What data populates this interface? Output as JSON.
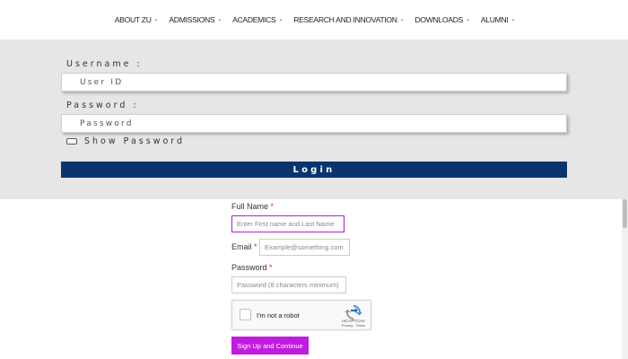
{
  "nav": {
    "items": [
      {
        "label": "ABOUT ZU"
      },
      {
        "label": "ADMISSIONS"
      },
      {
        "label": "ACADEMICS"
      },
      {
        "label": "RESEARCH AND INNOVATION"
      },
      {
        "label": "DOWNLOADS"
      },
      {
        "label": "ALUMNI"
      }
    ],
    "dropdown_icon": "chevron-down-icon"
  },
  "login": {
    "username_label": "Username :",
    "username_placeholder": "User ID",
    "password_label": "Password :",
    "password_placeholder": "Password",
    "show_password_label": "Show Password",
    "login_button": "Login"
  },
  "signup": {
    "fullname_label": "Full Name",
    "fullname_placeholder": "Enter First name and Last Name",
    "email_label": "Email",
    "email_placeholder": "Example@something.com",
    "password_label": "Password",
    "password_placeholder": "Password (8 characters minimum)",
    "required_mark": "*",
    "captcha_text": "I'm not a robot",
    "captcha_brand": "reCAPTCHA",
    "captcha_links": "Privacy - Terms",
    "submit_button": "Sign Up and Continue"
  },
  "colors": {
    "accent": "#c21be0",
    "login_button": "#0a3470",
    "panel_bg": "#e6e6e6"
  }
}
